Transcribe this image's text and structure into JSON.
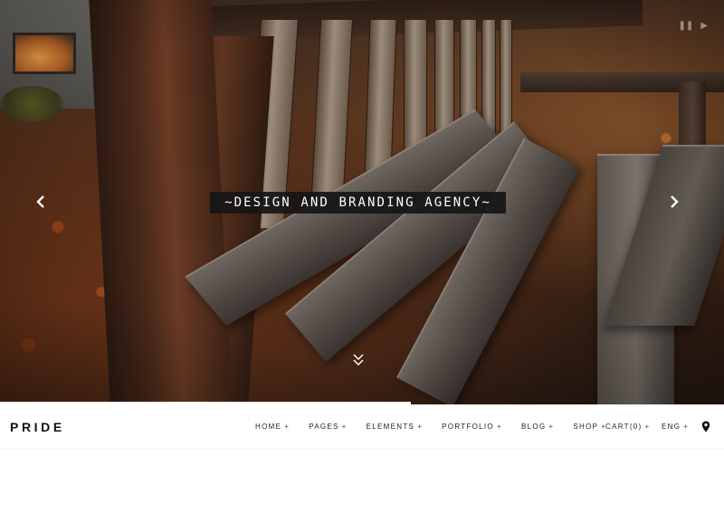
{
  "hero": {
    "tagline": "~DESIGN AND BRANDING AGENCY~",
    "prev_arrow": "‹",
    "next_arrow": "›",
    "pause_icon": "❚❚",
    "play_icon": "▶",
    "scroll_icon": "double-chevron-down-icon",
    "slide_progress": 0.567
  },
  "navbar": {
    "logo": "PRIDE",
    "menu": [
      {
        "label": "HOME",
        "suffix": "+"
      },
      {
        "label": "PAGES",
        "suffix": "+"
      },
      {
        "label": "ELEMENTS",
        "suffix": "+"
      },
      {
        "label": "PORTFOLIO",
        "suffix": "+"
      },
      {
        "label": "BLOG",
        "suffix": "+"
      },
      {
        "label": "SHOP",
        "suffix": "+"
      }
    ],
    "cart": {
      "label": "CART(0)",
      "suffix": "+"
    },
    "lang": {
      "label": "ENG",
      "suffix": "+"
    },
    "location_icon": "map-pin-icon"
  },
  "colors": {
    "nav_bg": "#ffffff",
    "nav_text": "#222222",
    "tagline_bg": "#161616",
    "tagline_text": "#ffffff"
  }
}
